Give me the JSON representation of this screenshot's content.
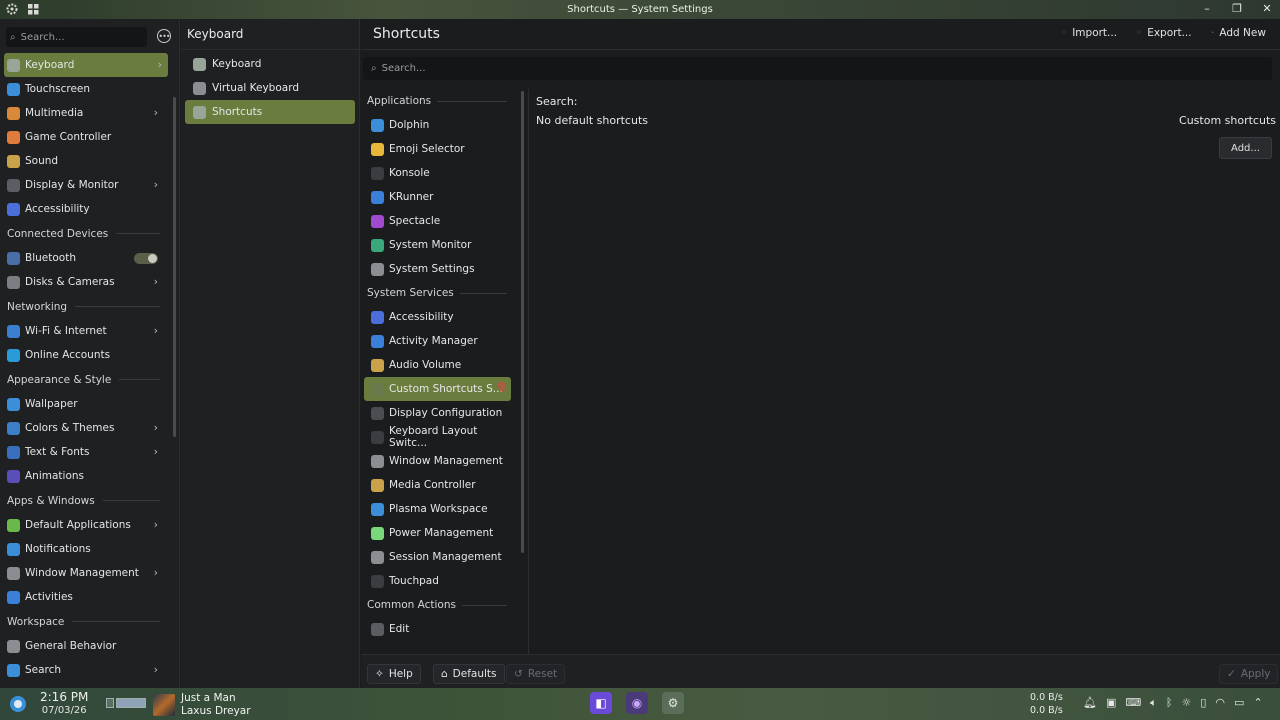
{
  "window": {
    "title": "Shortcuts — System Settings"
  },
  "sidebar": {
    "search_placeholder": "Search...",
    "items": [
      {
        "type": "item",
        "label": "Keyboard",
        "icon": "keyboard-icon",
        "color": "#9aa59a",
        "chevron": true,
        "selected": true
      },
      {
        "type": "item",
        "label": "Touchscreen",
        "icon": "touchscreen-icon",
        "color": "#3a8fd8"
      },
      {
        "type": "item",
        "label": "Multimedia",
        "icon": "multimedia-icon",
        "color": "#d88a3a",
        "chevron": true
      },
      {
        "type": "item",
        "label": "Game Controller",
        "icon": "gamepad-icon",
        "color": "#e07b3e"
      },
      {
        "type": "item",
        "label": "Sound",
        "icon": "sound-icon",
        "color": "#c9a24a"
      },
      {
        "type": "item",
        "label": "Display & Monitor",
        "icon": "monitor-icon",
        "color": "#5a5d63",
        "chevron": true
      },
      {
        "type": "item",
        "label": "Accessibility",
        "icon": "accessibility-icon",
        "color": "#4a6fd8"
      },
      {
        "type": "header",
        "label": "Connected Devices"
      },
      {
        "type": "item",
        "label": "Bluetooth",
        "icon": "bluetooth-icon",
        "color": "#4a6fa8",
        "toggle": true
      },
      {
        "type": "item",
        "label": "Disks & Cameras",
        "icon": "disks-icon",
        "color": "#7a7d82",
        "chevron": true
      },
      {
        "type": "header",
        "label": "Networking"
      },
      {
        "type": "item",
        "label": "Wi-Fi & Internet",
        "icon": "wifi-icon",
        "color": "#3a7fd0",
        "chevron": true
      },
      {
        "type": "item",
        "label": "Online Accounts",
        "icon": "cloud-icon",
        "color": "#2a9ad8"
      },
      {
        "type": "header",
        "label": "Appearance & Style"
      },
      {
        "type": "item",
        "label": "Wallpaper",
        "icon": "wallpaper-icon",
        "color": "#3a8fd8"
      },
      {
        "type": "item",
        "label": "Colors & Themes",
        "icon": "palette-icon",
        "color": "#3a7fc8",
        "chevron": true
      },
      {
        "type": "item",
        "label": "Text & Fonts",
        "icon": "fonts-icon",
        "color": "#3a6fc0",
        "chevron": true
      },
      {
        "type": "item",
        "label": "Animations",
        "icon": "animations-icon",
        "color": "#5a4fb8"
      },
      {
        "type": "header",
        "label": "Apps & Windows"
      },
      {
        "type": "item",
        "label": "Default Applications",
        "icon": "default-apps-icon",
        "color": "#6ab84a",
        "chevron": true
      },
      {
        "type": "item",
        "label": "Notifications",
        "icon": "notifications-icon",
        "color": "#3a8fd8"
      },
      {
        "type": "item",
        "label": "Window Management",
        "icon": "window-icon",
        "color": "#8a8d92",
        "chevron": true
      },
      {
        "type": "item",
        "label": "Activities",
        "icon": "activities-icon",
        "color": "#3a7fd8"
      },
      {
        "type": "header",
        "label": "Workspace"
      },
      {
        "type": "item",
        "label": "General Behavior",
        "icon": "gear-icon",
        "color": "#8a8d92"
      },
      {
        "type": "item",
        "label": "Search",
        "icon": "search-icon",
        "color": "#3a8fd8",
        "chevron": true
      }
    ]
  },
  "subnav": {
    "title": "Keyboard",
    "items": [
      {
        "label": "Keyboard",
        "icon": "keyboard-icon",
        "color": "#9aa59a"
      },
      {
        "label": "Virtual Keyboard",
        "icon": "virtual-keyboard-icon",
        "color": "#8a8d92"
      },
      {
        "label": "Shortcuts",
        "icon": "shortcuts-icon",
        "color": "#9aa59a",
        "selected": true
      }
    ]
  },
  "main": {
    "title": "Shortcuts",
    "actions": {
      "import": "Import...",
      "export": "Export...",
      "add_new": "Add New"
    },
    "search_placeholder": "Search...",
    "groups": [
      {
        "type": "header",
        "label": "Applications"
      },
      {
        "type": "item",
        "label": "Dolphin",
        "icon": "folder-icon",
        "color": "#3a8fd8"
      },
      {
        "type": "item",
        "label": "Emoji Selector",
        "icon": "emoji-icon",
        "color": "#e8b83a"
      },
      {
        "type": "item",
        "label": "Konsole",
        "icon": "terminal-icon",
        "color": "#3a3d42"
      },
      {
        "type": "item",
        "label": "KRunner",
        "icon": "krunner-icon",
        "color": "#3a7fd8"
      },
      {
        "type": "item",
        "label": "Spectacle",
        "icon": "spectacle-icon",
        "color": "#a04ad0"
      },
      {
        "type": "item",
        "label": "System Monitor",
        "icon": "system-monitor-icon",
        "color": "#3aa87a"
      },
      {
        "type": "item",
        "label": "System Settings",
        "icon": "settings-icon",
        "color": "#8a8d92"
      },
      {
        "type": "header",
        "label": "System Services"
      },
      {
        "type": "item",
        "label": "Accessibility",
        "icon": "accessibility-icon",
        "color": "#4a6fd8"
      },
      {
        "type": "item",
        "label": "Activity Manager",
        "icon": "activity-manager-icon",
        "color": "#3a7fd8"
      },
      {
        "type": "item",
        "label": "Audio Volume",
        "icon": "audio-icon",
        "color": "#c9a24a"
      },
      {
        "type": "item",
        "label": "Custom Shortcuts S...",
        "icon": "custom-shortcuts-icon",
        "color": "#6a7a4a",
        "selected": true,
        "trash": true
      },
      {
        "type": "item",
        "label": "Display Configuration",
        "icon": "display-icon",
        "color": "#4a4d52"
      },
      {
        "type": "item",
        "label": "Keyboard Layout Switc...",
        "icon": "keyboard-layout-icon",
        "color": "#3a3d42"
      },
      {
        "type": "item",
        "label": "Window Management",
        "icon": "window-icon",
        "color": "#8a8d92"
      },
      {
        "type": "item",
        "label": "Media Controller",
        "icon": "media-icon",
        "color": "#c9a24a"
      },
      {
        "type": "item",
        "label": "Plasma Workspace",
        "icon": "plasma-icon",
        "color": "#3a8fd8"
      },
      {
        "type": "item",
        "label": "Power Management",
        "icon": "power-icon",
        "color": "#7ad87a"
      },
      {
        "type": "item",
        "label": "Session Management",
        "icon": "session-icon",
        "color": "#8a8d92"
      },
      {
        "type": "item",
        "label": "Touchpad",
        "icon": "touchpad-icon",
        "color": "#3a3d42"
      },
      {
        "type": "header",
        "label": "Common Actions"
      },
      {
        "type": "item",
        "label": "Edit",
        "icon": "edit-icon",
        "color": "#5a5d62"
      }
    ],
    "detail": {
      "search_label": "Search:",
      "no_default": "No default shortcuts",
      "custom_label": "Custom shortcuts",
      "add_button": "Add..."
    },
    "footer": {
      "help": "Help",
      "defaults": "Defaults",
      "reset": "Reset",
      "apply": "Apply"
    }
  },
  "taskbar": {
    "time": "2:16 PM",
    "date": "07/03/26",
    "media_title": "Just a Man",
    "media_artist": "Laxus Dreyar",
    "net_down": "0.0 B/s",
    "net_up": "0.0 B/s"
  }
}
